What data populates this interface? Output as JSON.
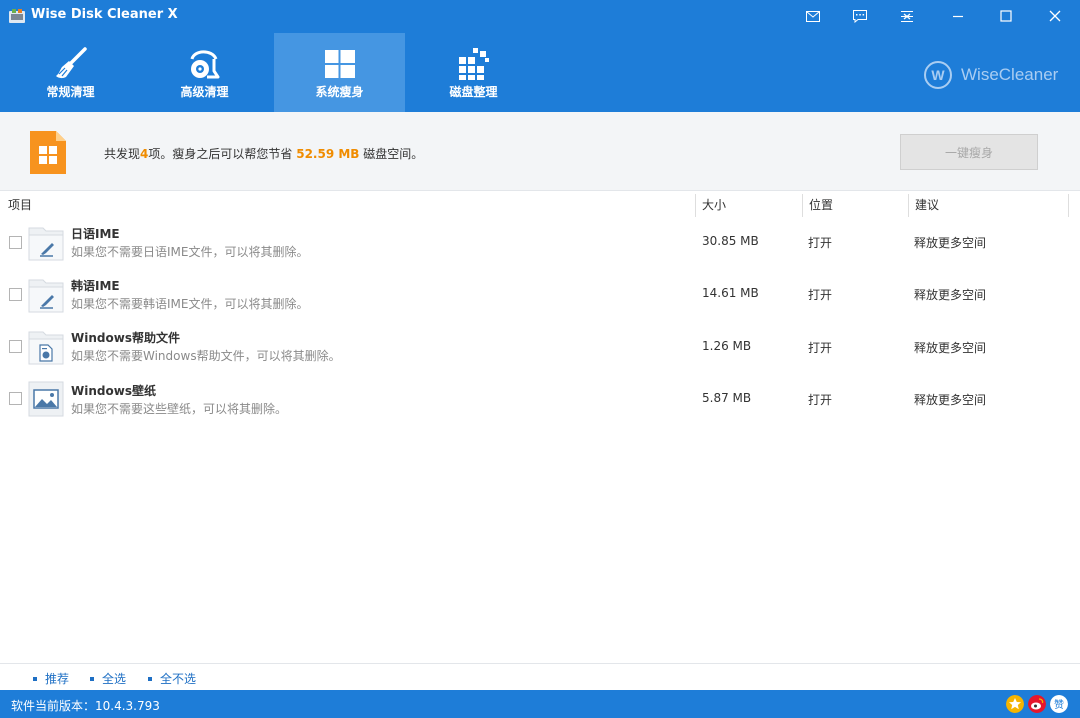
{
  "app": {
    "title": "Wise Disk Cleaner X"
  },
  "tabs": [
    {
      "label": "常规清理",
      "icon": "broom-icon"
    },
    {
      "label": "高级清理",
      "icon": "vacuum-icon"
    },
    {
      "label": "系统瘦身",
      "icon": "windows-icon",
      "active": true
    },
    {
      "label": "磁盘整理",
      "icon": "defrag-icon"
    }
  ],
  "brand": {
    "name": "WiseCleaner",
    "logo_letter": "W"
  },
  "summary": {
    "prefix": "共发现",
    "count": "4",
    "middle": "项。瘦身之后可以帮您节省",
    "size": "52.59 MB",
    "suffix": "磁盘空间。",
    "button_label": "一键瘦身"
  },
  "table": {
    "columns": [
      "项目",
      "大小",
      "位置",
      "建议"
    ],
    "rows": [
      {
        "name": "日语IME",
        "desc": "如果您不需要日语IME文件，可以将其删除。",
        "size": "30.85 MB",
        "location": "打开",
        "advice": "释放更多空间",
        "icon": "ime-file-icon"
      },
      {
        "name": "韩语IME",
        "desc": "如果您不需要韩语IME文件，可以将其删除。",
        "size": "14.61 MB",
        "location": "打开",
        "advice": "释放更多空间",
        "icon": "ime-file-icon"
      },
      {
        "name": "Windows帮助文件",
        "desc": "如果您不需要Windows帮助文件，可以将其删除。",
        "size": "1.26 MB",
        "location": "打开",
        "advice": "释放更多空间",
        "icon": "help-file-icon"
      },
      {
        "name": "Windows壁纸",
        "desc": "如果您不需要这些壁纸，可以将其删除。",
        "size": "5.87 MB",
        "location": "打开",
        "advice": "释放更多空间",
        "icon": "wallpaper-icon"
      }
    ]
  },
  "footer": {
    "links": [
      "推荐",
      "全选",
      "全不选"
    ],
    "version_label": "软件当前版本：",
    "version": "10.4.3.793",
    "status_icon_b_label": "赞"
  },
  "colors": {
    "header_bg": "#1e7dd8",
    "active_tab": "#4596e2",
    "accent_orange": "#f08c00",
    "link_blue": "#1e6fc4"
  }
}
